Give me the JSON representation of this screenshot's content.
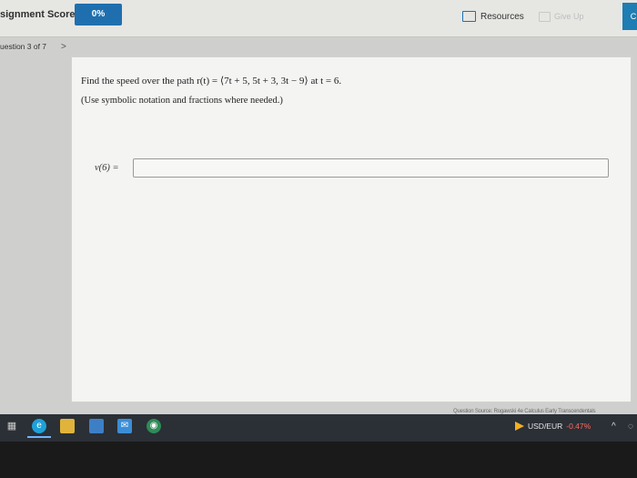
{
  "header": {
    "score_label": "signment Score:",
    "score_value": "0%",
    "resources_label": "Resources",
    "give_up_label": "Give Up",
    "check_label": "C"
  },
  "nav": {
    "question_counter": "uestion 3 of 7",
    "next_chevron": ">"
  },
  "question": {
    "prompt": "Find the speed over the path r(t) = ⟨7t + 5, 5t + 3, 3t − 9⟩ at t = 6.",
    "note": "(Use symbolic notation and fractions where needed.)",
    "answer_label": "v(6) =",
    "answer_value": ""
  },
  "footer": {
    "source_line": "Question Source: Rogawski 4e Calculus Early Transcendentals"
  },
  "taskbar": {
    "icons": [
      "task-view-icon",
      "edge-icon",
      "file-explorer-icon",
      "store-icon",
      "mail-icon",
      "chrome-icon"
    ],
    "ticker_label": "USD/EUR",
    "ticker_change": "-0.47%"
  },
  "colors": {
    "accent": "#1f6fae",
    "taskbar": "#2b2f36",
    "negative": "#ff6b5f"
  }
}
